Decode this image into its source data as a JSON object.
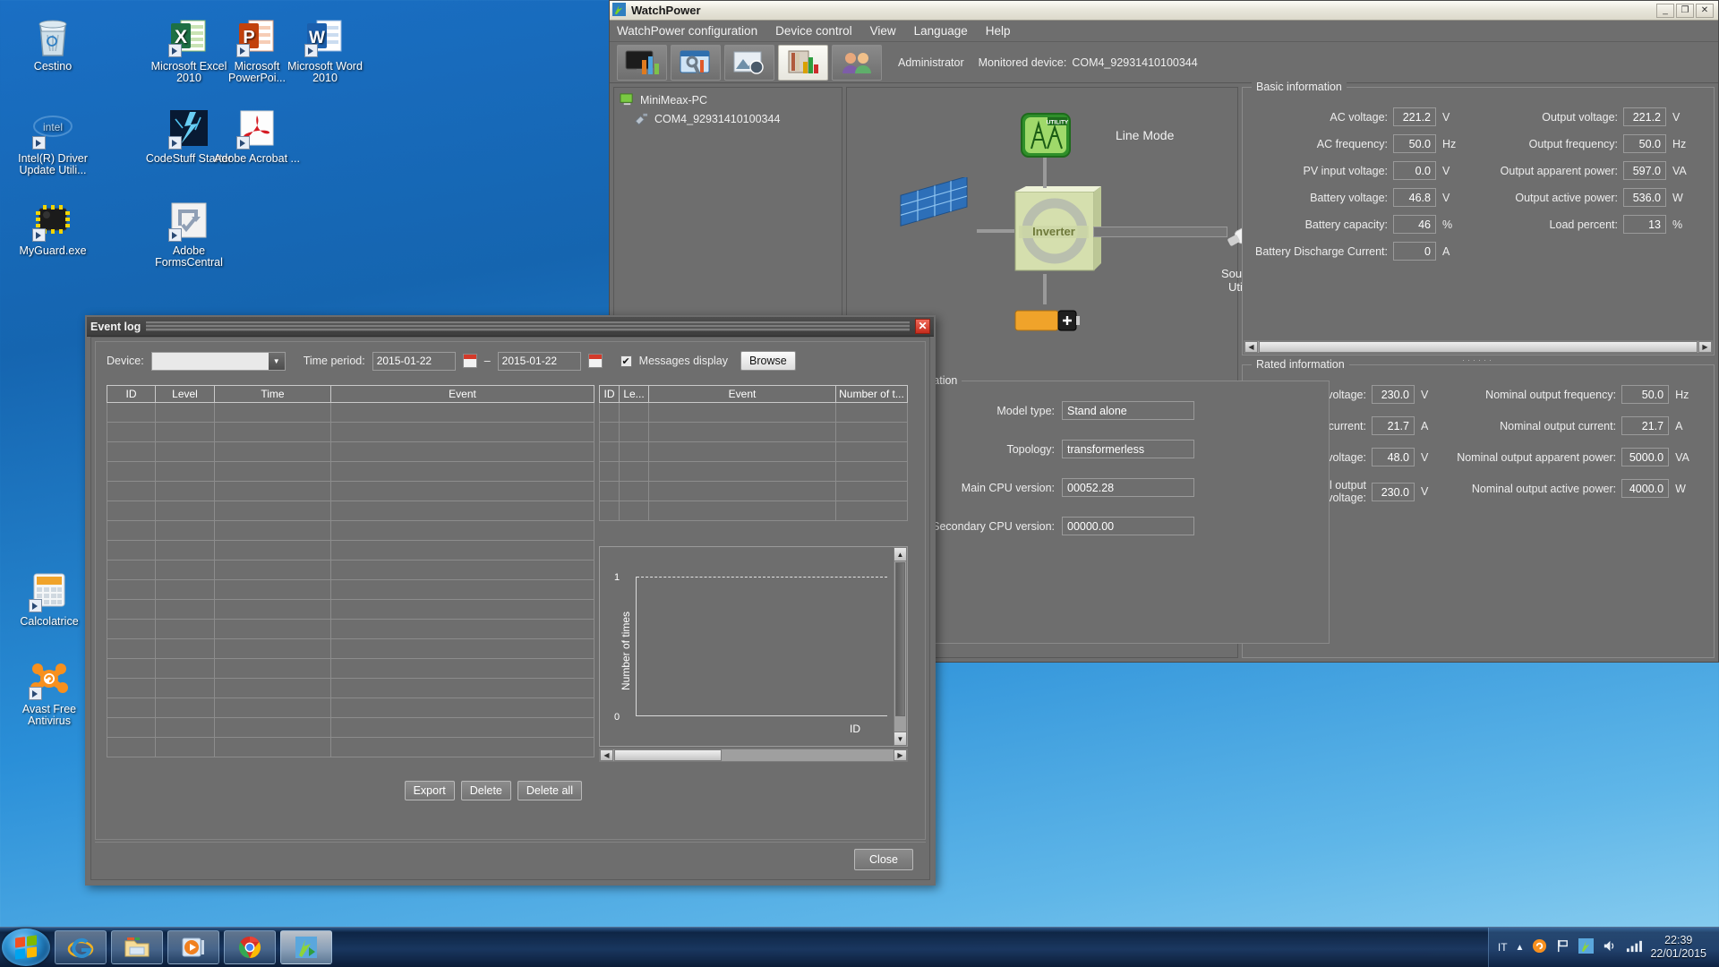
{
  "desktop": {
    "icons": [
      {
        "name": "recycle-bin",
        "label": "Cestino",
        "col": 0,
        "row": 0,
        "shortcut": false
      },
      {
        "name": "intel-driver-update",
        "label": "Intel(R) Driver Update Utili...",
        "col": 0,
        "row": 1,
        "shortcut": true
      },
      {
        "name": "myguard-exe",
        "label": "MyGuard.exe",
        "col": 0,
        "row": 2,
        "shortcut": true
      },
      {
        "name": "microsoft-excel-2010",
        "label": "Microsoft Excel 2010",
        "col": 1,
        "row": 0,
        "shortcut": true
      },
      {
        "name": "codestuff-starter",
        "label": "CodeStuff Starter",
        "col": 1,
        "row": 1,
        "shortcut": true
      },
      {
        "name": "adobe-formscentral",
        "label": "Adobe FormsCentral",
        "col": 1,
        "row": 2,
        "shortcut": true
      },
      {
        "name": "microsoft-powerpoint-2010",
        "label": "Microsoft PowerPoi...",
        "col": 2,
        "row": 0,
        "shortcut": true
      },
      {
        "name": "adobe-acrobat",
        "label": "Adobe Acrobat ...",
        "col": 2,
        "row": 1,
        "shortcut": true
      },
      {
        "name": "microsoft-word-2010",
        "label": "Microsoft Word 2010",
        "col": 3,
        "row": 0,
        "shortcut": true
      }
    ],
    "icons_lower": [
      {
        "name": "calculator",
        "label": "Calcolatrice",
        "shortcut": true
      },
      {
        "name": "avast-free-antivirus",
        "label": "Avast Free Antivirus",
        "shortcut": true
      }
    ]
  },
  "taskbar": {
    "start_tooltip": "Start",
    "buttons": [
      {
        "name": "internet-explorer",
        "label": "Internet Explorer",
        "active": false
      },
      {
        "name": "windows-explorer",
        "label": "Windows Explorer",
        "active": false
      },
      {
        "name": "windows-media-player",
        "label": "Windows Media Player",
        "active": false
      },
      {
        "name": "google-chrome",
        "label": "Google Chrome",
        "active": false
      },
      {
        "name": "watchpower",
        "label": "WatchPower",
        "active": true
      }
    ],
    "tray": {
      "language": "IT",
      "icons": [
        "show-hidden-icons",
        "avast-tray-icon",
        "action-center-flag",
        "watchpower-tray-icon",
        "volume-icon",
        "network-signal-icon"
      ],
      "time": "22:39",
      "date": "22/01/2015"
    }
  },
  "watchpower": {
    "title": "WatchPower",
    "window_buttons": [
      "minimize",
      "maximize",
      "close"
    ],
    "menu": [
      "WatchPower configuration",
      "Device control",
      "View",
      "Language",
      "Help"
    ],
    "toolbar_icons": [
      "monitor-chart-icon",
      "settings-wrench-icon",
      "picture-globe-icon",
      "bar-chart-books-icon",
      "users-icon"
    ],
    "user": "Administrator",
    "monitored_device_label": "Monitored device:",
    "monitored_device": "COM4_92931410100344",
    "tree": {
      "root": "MiniMeax-PC",
      "child": "COM4_92931410100344"
    },
    "diagram": {
      "mode": "Line Mode",
      "source_label": "Source:",
      "source_value": "Utility",
      "utility_label": "UTILITY",
      "inverter_label": "Inverter"
    },
    "basic_information": {
      "title": "Basic information",
      "left": [
        {
          "label": "AC voltage:",
          "value": "221.2",
          "unit": "V"
        },
        {
          "label": "AC frequency:",
          "value": "50.0",
          "unit": "Hz"
        },
        {
          "label": "PV input voltage:",
          "value": "0.0",
          "unit": "V"
        },
        {
          "label": "Battery voltage:",
          "value": "46.8",
          "unit": "V"
        },
        {
          "label": "Battery capacity:",
          "value": "46",
          "unit": "%"
        },
        {
          "label": "Battery Discharge Current:",
          "value": "0",
          "unit": "A"
        }
      ],
      "right": [
        {
          "label": "Output voltage:",
          "value": "221.2",
          "unit": "V"
        },
        {
          "label": "Output frequency:",
          "value": "50.0",
          "unit": "Hz"
        },
        {
          "label": "Output apparent power:",
          "value": "597.0",
          "unit": "VA"
        },
        {
          "label": "Output active power:",
          "value": "536.0",
          "unit": "W"
        },
        {
          "label": "Load percent:",
          "value": "13",
          "unit": "%"
        }
      ]
    },
    "product_information": {
      "title": "Product information",
      "fields": [
        {
          "label": "Model type:",
          "value": "Stand alone"
        },
        {
          "label": "Topology:",
          "value": "transformerless"
        },
        {
          "label": "Main CPU version:",
          "value": "00052.28"
        },
        {
          "label": "Secondary CPU version:",
          "value": "00000.00"
        }
      ]
    },
    "rated_information": {
      "title": "Rated information",
      "left": [
        {
          "label": "Nominal AC voltage:",
          "value": "230.0",
          "unit": "V"
        },
        {
          "label": "Nominal AC current:",
          "value": "21.7",
          "unit": "A"
        },
        {
          "label": "Rated battery voltage:",
          "value": "48.0",
          "unit": "V"
        },
        {
          "label": "Nominal output voltage:",
          "value": "230.0",
          "unit": "V"
        }
      ],
      "right": [
        {
          "label": "Nominal output frequency:",
          "value": "50.0",
          "unit": "Hz"
        },
        {
          "label": "Nominal output current:",
          "value": "21.7",
          "unit": "A"
        },
        {
          "label": "Nominal output apparent power:",
          "value": "5000.0",
          "unit": "VA"
        },
        {
          "label": "Nominal output active power:",
          "value": "4000.0",
          "unit": "W"
        }
      ]
    }
  },
  "event_log": {
    "title": "Event log",
    "close_glyph": "✕",
    "controls": {
      "device_label": "Device:",
      "device_value": "",
      "time_period_label": "Time period:",
      "date_from": "2015-01-22",
      "date_to": "2015-01-22",
      "date_separator": "–",
      "messages_display_label": "Messages display",
      "messages_display_checked": true,
      "browse_button": "Browse"
    },
    "left_table": {
      "columns": [
        "ID",
        "Level",
        "Time",
        "Event"
      ],
      "rows": []
    },
    "right_table": {
      "columns": [
        "ID",
        "Le...",
        "Event",
        "Number of t..."
      ],
      "rows": []
    },
    "buttons": {
      "export": "Export",
      "delete": "Delete",
      "delete_all": "Delete all",
      "close": "Close"
    },
    "chart_data": {
      "type": "bar",
      "title": "",
      "xlabel": "ID",
      "ylabel": "Number of times",
      "categories": [],
      "values": [],
      "ylim": [
        0,
        1
      ],
      "yticks": [
        "0",
        "1"
      ],
      "grid": true,
      "legend": "none"
    }
  }
}
